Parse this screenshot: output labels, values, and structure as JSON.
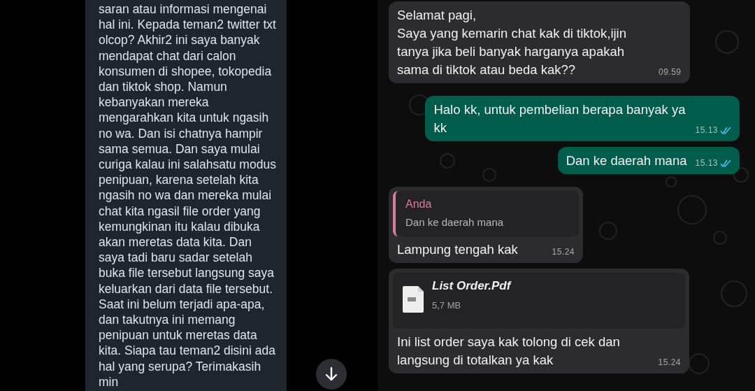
{
  "post": {
    "text": "saran atau informasi mengenai hal ini. Kepada teman2 twitter txt olcop? Akhir2 ini saya banyak mendapat chat dari calon konsumen di shopee, tokopedia dan tiktok shop. Namun kebanyakan mereka mengarahkan kita untuk ngasih no wa. Dan isi chatnya hampir sama semua. Dan saya mulai curiga kalau ini salahsatu modus penipuan, karena setelah kita ngasih no wa dan mereka mulai chat kita ngasil file order yang kemungkinan itu kalau dibuka akan meretas data kita. Dan saya tadi baru sadar setelah buka file tersebut langsung saya keluarkan dari data file tersebut. Saat ini belum terjadi apa-apa, dan takutnya ini memang penipuan untuk meretas data kita. Siapa tau teman2 disini ada hal yang serupa? Terimakasih min"
  },
  "chat": {
    "messages": [
      {
        "kind": "text",
        "outgoing": false,
        "text": "Selamat pagi,\nSaya yang kemarin chat kak di tiktok,ijin tanya jika beli banyak harganya apakah sama di tiktok atau beda kak??",
        "time": "09.59"
      },
      {
        "kind": "text",
        "outgoing": true,
        "read": true,
        "text": "Halo kk, untuk pembelian berapa banyak ya kk",
        "time": "15.13"
      },
      {
        "kind": "text",
        "outgoing": true,
        "read": true,
        "text": "Dan ke daerah mana",
        "time": "15.13"
      },
      {
        "kind": "reply",
        "outgoing": false,
        "quote_author": "Anda",
        "quote_text": "Dan ke daerah mana",
        "text": "Lampung tengah kak",
        "time": "15.24"
      },
      {
        "kind": "document",
        "outgoing": false,
        "file_name": "List Order.Pdf",
        "file_size": "5,7 MB",
        "text": "Ini list order saya kak tolong di cek dan langsung di totalkan ya kak",
        "time": "15.24"
      }
    ]
  }
}
